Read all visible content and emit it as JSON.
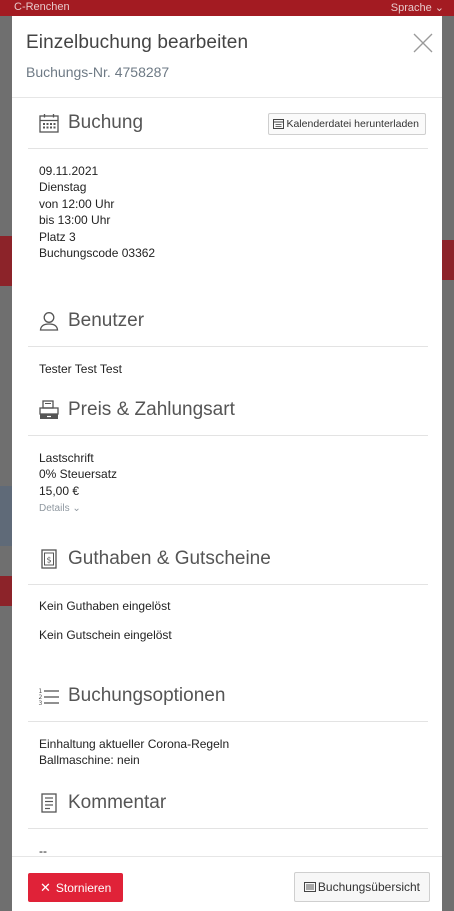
{
  "background": {
    "top_left_text": "C-Renchen",
    "top_right_text": "Sprache ⌄"
  },
  "modal": {
    "title": "Einzelbuchung bearbeiten",
    "subtitle": "Buchungs-Nr. 4758287",
    "close_icon": "close-icon"
  },
  "sections": {
    "buchung": {
      "title": "Buchung",
      "icon": "calendar-icon",
      "calendar_button_label": "Kalenderdatei herunterladen",
      "lines": [
        "09.11.2021",
        "Dienstag",
        "von 12:00 Uhr",
        "bis 13:00 Uhr",
        "Platz 3",
        "Buchungscode 03362"
      ]
    },
    "benutzer": {
      "title": "Benutzer",
      "icon": "user-icon",
      "lines": [
        "Tester Test Test"
      ]
    },
    "preis": {
      "title": "Preis & Zahlungsart",
      "icon": "cash-register-icon",
      "lines": [
        "Lastschrift",
        "0% Steuersatz",
        "15,00 €"
      ],
      "details_label": "Details ⌄"
    },
    "guthaben": {
      "title": "Guthaben & Gutscheine",
      "icon": "voucher-icon",
      "lines": [
        "Kein Guthaben eingelöst",
        "Kein Gutschein eingelöst"
      ]
    },
    "optionen": {
      "title": "Buchungsoptionen",
      "icon": "list-icon",
      "lines": [
        "Einhaltung aktueller Corona-Regeln",
        "Ballmaschine: nein"
      ]
    },
    "kommentar": {
      "title": "Kommentar",
      "icon": "document-icon",
      "lines": [
        "--"
      ]
    }
  },
  "footer": {
    "cancel_label": "Stornieren",
    "overview_label": "Buchungsübersicht"
  },
  "colors": {
    "cancel_button": "#e02238",
    "header_red": "#a31b22"
  }
}
